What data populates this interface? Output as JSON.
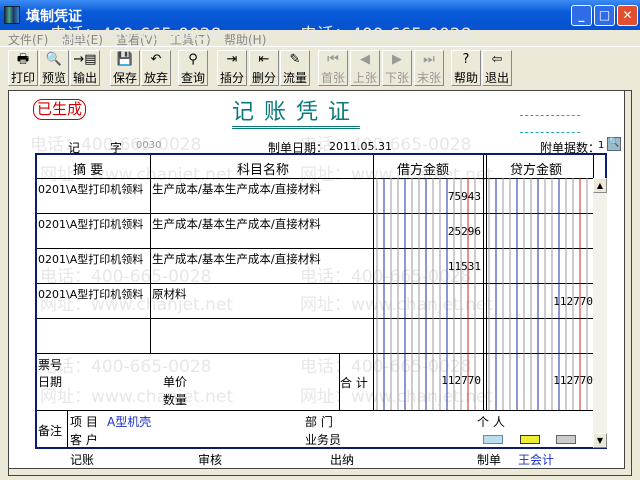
{
  "window": {
    "title": "填制凭证"
  },
  "menu": [
    "文件(F)",
    "制单(E)",
    "查看(V)",
    "工具(T)",
    "帮助(H)"
  ],
  "toolbar": [
    {
      "label": "打印",
      "icon": "printer-icon",
      "glyph": "🖶",
      "enabled": true
    },
    {
      "label": "预览",
      "icon": "preview-icon",
      "glyph": "🔍",
      "enabled": true
    },
    {
      "label": "输出",
      "icon": "export-icon",
      "glyph": "→▤",
      "enabled": true
    },
    {
      "label": "保存",
      "icon": "save-icon",
      "glyph": "💾",
      "enabled": true
    },
    {
      "label": "放弃",
      "icon": "undo-icon",
      "glyph": "↶",
      "enabled": true
    },
    {
      "label": "查询",
      "icon": "binoculars-icon",
      "glyph": "⚲",
      "enabled": true
    },
    {
      "label": "插分",
      "icon": "insert-row-icon",
      "glyph": "⇥",
      "enabled": true
    },
    {
      "label": "删分",
      "icon": "delete-row-icon",
      "glyph": "⇤",
      "enabled": true
    },
    {
      "label": "流量",
      "icon": "cashflow-icon",
      "glyph": "✎",
      "enabled": true
    },
    {
      "label": "首张",
      "icon": "first-icon",
      "glyph": "⏮",
      "enabled": false
    },
    {
      "label": "上张",
      "icon": "prev-icon",
      "glyph": "◀",
      "enabled": false
    },
    {
      "label": "下张",
      "icon": "next-icon",
      "glyph": "▶",
      "enabled": false
    },
    {
      "label": "末张",
      "icon": "last-icon",
      "glyph": "⏭",
      "enabled": false
    },
    {
      "label": "帮助",
      "icon": "help-icon",
      "glyph": "?",
      "enabled": true
    },
    {
      "label": "退出",
      "icon": "exit-icon",
      "glyph": "⇦",
      "enabled": true
    }
  ],
  "watermark": {
    "phone": "电话：400-665-0028",
    "site": "网址：www.chanjet.net"
  },
  "voucher": {
    "status_stamp": "已生成",
    "title": "记账凭证",
    "type_char": "记",
    "zi": "字",
    "number": "0030",
    "date_label": "制单日期：",
    "date": "2011.05.31",
    "attach_label": "附单据数：",
    "attach_count": "1",
    "headers": {
      "summary": "摘 要",
      "account": "科目名称",
      "debit": "借方金额",
      "credit": "贷方金额"
    },
    "rows": [
      {
        "summary": "0201\\A型打印机领料",
        "account": "生产成本/基本生产成本/直接材料",
        "debit": "75943",
        "credit": ""
      },
      {
        "summary": "0201\\A型打印机领料",
        "account": "生产成本/基本生产成本/直接材料",
        "debit": "25296",
        "credit": ""
      },
      {
        "summary": "0201\\A型打印机领料",
        "account": "生产成本/基本生产成本/直接材料",
        "debit": "11531",
        "credit": ""
      },
      {
        "summary": "0201\\A型打印机领料",
        "account": "原材料",
        "debit": "",
        "credit": "112770"
      },
      {
        "summary": "",
        "account": "",
        "debit": "",
        "credit": ""
      }
    ],
    "footer": {
      "ticket": "票号",
      "date": "日期",
      "unit_price": "单价",
      "quantity": "数量",
      "total_label": "合 计",
      "total_debit": "112770",
      "total_credit": "112770"
    },
    "remarks": {
      "label": "备注",
      "project_label": "项 目",
      "project": "A型机壳",
      "customer_label": "客 户",
      "dept_label": "部 门",
      "salesman_label": "业务员",
      "person_label": "个 人"
    },
    "signatures": {
      "bookkeeping": "记账",
      "audit": "审核",
      "cashier": "出纳",
      "maker_label": "制单",
      "maker": "王会计"
    }
  },
  "colors": {
    "title": "#0a7a7a",
    "stamp": "#cc0000",
    "grid_blue": "#1a2fa8",
    "grid_red": "#cc2222",
    "name_blue": "#1a2fc8"
  }
}
